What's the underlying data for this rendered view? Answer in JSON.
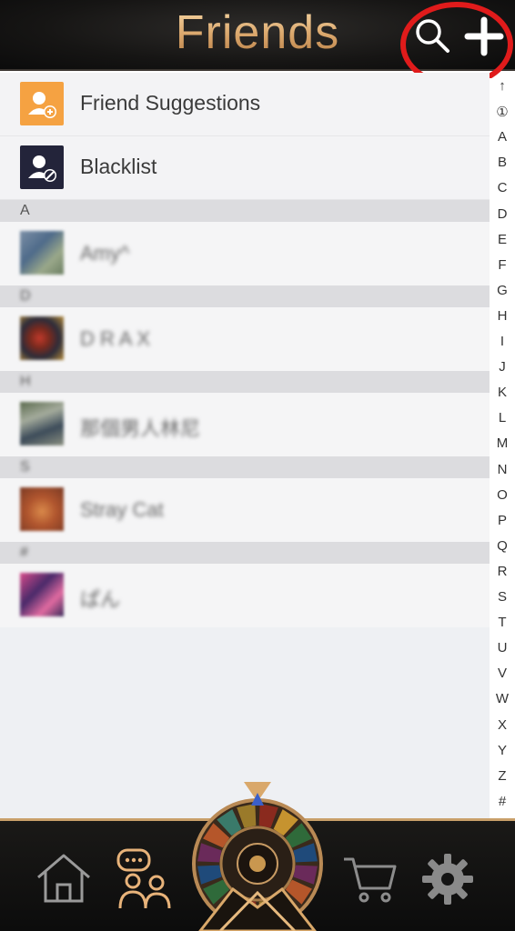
{
  "header": {
    "title": "Friends"
  },
  "fixed_items": [
    {
      "label": "Friend Suggestions",
      "icon": "friend-suggestion-icon",
      "color": "#f5a242"
    },
    {
      "label": "Blacklist",
      "icon": "blacklist-icon",
      "color": "#23243a"
    }
  ],
  "sections": [
    {
      "letter": "A",
      "friends": [
        {
          "name": "Amy^"
        }
      ]
    },
    {
      "letter": "D",
      "friends": [
        {
          "name": "D R A X"
        }
      ]
    },
    {
      "letter": "H",
      "friends": [
        {
          "name": "那個男人林尼"
        }
      ]
    },
    {
      "letter": "S",
      "friends": [
        {
          "name": "Stray Cat"
        }
      ]
    },
    {
      "letter": "#",
      "friends": [
        {
          "name": "ぱん"
        }
      ]
    }
  ],
  "alphabet_index": [
    "↑",
    "①",
    "A",
    "B",
    "C",
    "D",
    "E",
    "F",
    "G",
    "H",
    "I",
    "J",
    "K",
    "L",
    "M",
    "N",
    "O",
    "P",
    "Q",
    "R",
    "S",
    "T",
    "U",
    "V",
    "W",
    "X",
    "Y",
    "Z",
    "#"
  ],
  "nav": {
    "items": [
      {
        "icon": "home-icon"
      },
      {
        "icon": "friends-chat-icon"
      },
      {
        "icon": "prize-wheel-icon"
      },
      {
        "icon": "cart-icon"
      },
      {
        "icon": "settings-gear-icon"
      }
    ]
  },
  "colors": {
    "header_bg": "#161514",
    "title_gold": "#d9a56a",
    "annotation_red": "#e01b1b",
    "section_bg": "#dcdcdf",
    "row_bg": "#f5f5f6"
  }
}
